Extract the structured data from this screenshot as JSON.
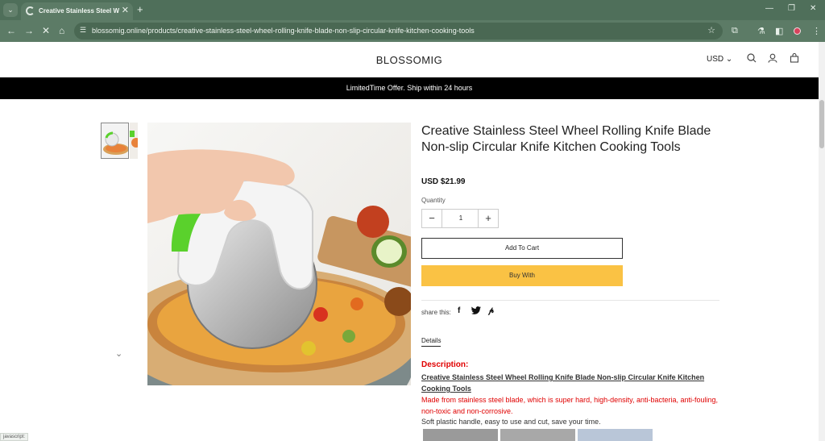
{
  "browser": {
    "tab_title": "Creative Stainless Steel Wheel Rolling Knife Blade",
    "url": "blossomig.online/products/creative-stainless-steel-wheel-rolling-knife-blade-non-slip-circular-knife-kitchen-cooking-tools",
    "status_text": "javascript:"
  },
  "header": {
    "logo": "BLOSSOMIG",
    "currency": "USD"
  },
  "announcement": "LimitedTime Offer. Ship within 24 hours",
  "product": {
    "title": "Creative Stainless Steel Wheel Rolling Knife Blade Non-slip Circular Knife Kitchen Cooking Tools",
    "price": "USD $21.99",
    "quantity_label": "Quantity",
    "quantity_value": "1",
    "add_to_cart": "Add To Cart",
    "buy_with": "Buy With",
    "share_label": "share this:",
    "details_tab": "Details"
  },
  "description": {
    "heading": "Description:",
    "title_link": "Creative Stainless Steel Wheel Rolling Knife Blade Non-slip Circular Knife Kitchen Cooking Tools",
    "feature_red": "Made from stainless steel blade, which is super hard, high-density, anti-bacteria, anti-fouling, non-toxic and non-corrosive.",
    "feature_plain": "Soft plastic handle, easy to use and cut, save your time."
  },
  "colors": {
    "chrome": "#5c7b66",
    "announcement_bg": "#000000",
    "buy_with": "#fac244",
    "description_red": "#e00000",
    "handle_green": "#5ad12c"
  }
}
